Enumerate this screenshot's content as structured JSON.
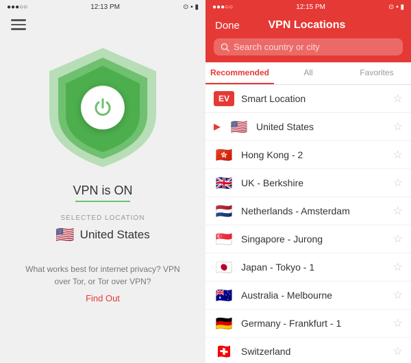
{
  "left": {
    "status_bar": {
      "time": "12:13 PM",
      "signal": "●●●○○"
    },
    "vpn_status": "VPN is ON",
    "selected_location_label": "SELECTED LOCATION",
    "selected_location": "United States",
    "promo_text": "What works best for internet privacy? VPN over Tor, or Tor over VPN?",
    "find_out_label": "Find Out"
  },
  "right": {
    "status_bar": {
      "time": "12:15 PM"
    },
    "done_label": "Done",
    "header_title": "VPN Locations",
    "search_placeholder": "Search country or city",
    "tabs": [
      {
        "label": "Recommended",
        "active": true
      },
      {
        "label": "All",
        "active": false
      },
      {
        "label": "Favorites",
        "active": false
      }
    ],
    "locations": [
      {
        "type": "smart",
        "name": "Smart Location",
        "expandable": false
      },
      {
        "type": "flag",
        "flag": "🇺🇸",
        "name": "United States",
        "expandable": true
      },
      {
        "type": "flag",
        "flag": "🇭🇰",
        "name": "Hong Kong - 2",
        "expandable": false
      },
      {
        "type": "flag",
        "flag": "🇬🇧",
        "name": "UK - Berkshire",
        "expandable": false
      },
      {
        "type": "flag",
        "flag": "🇳🇱",
        "name": "Netherlands - Amsterdam",
        "expandable": false
      },
      {
        "type": "flag",
        "flag": "🇸🇬",
        "name": "Singapore - Jurong",
        "expandable": false
      },
      {
        "type": "flag",
        "flag": "🇯🇵",
        "name": "Japan - Tokyo - 1",
        "expandable": false
      },
      {
        "type": "flag",
        "flag": "🇦🇺",
        "name": "Australia - Melbourne",
        "expandable": false
      },
      {
        "type": "flag",
        "flag": "🇩🇪",
        "name": "Germany - Frankfurt - 1",
        "expandable": false
      },
      {
        "type": "flag",
        "flag": "🇨🇭",
        "name": "Switzerland",
        "expandable": false
      }
    ]
  }
}
